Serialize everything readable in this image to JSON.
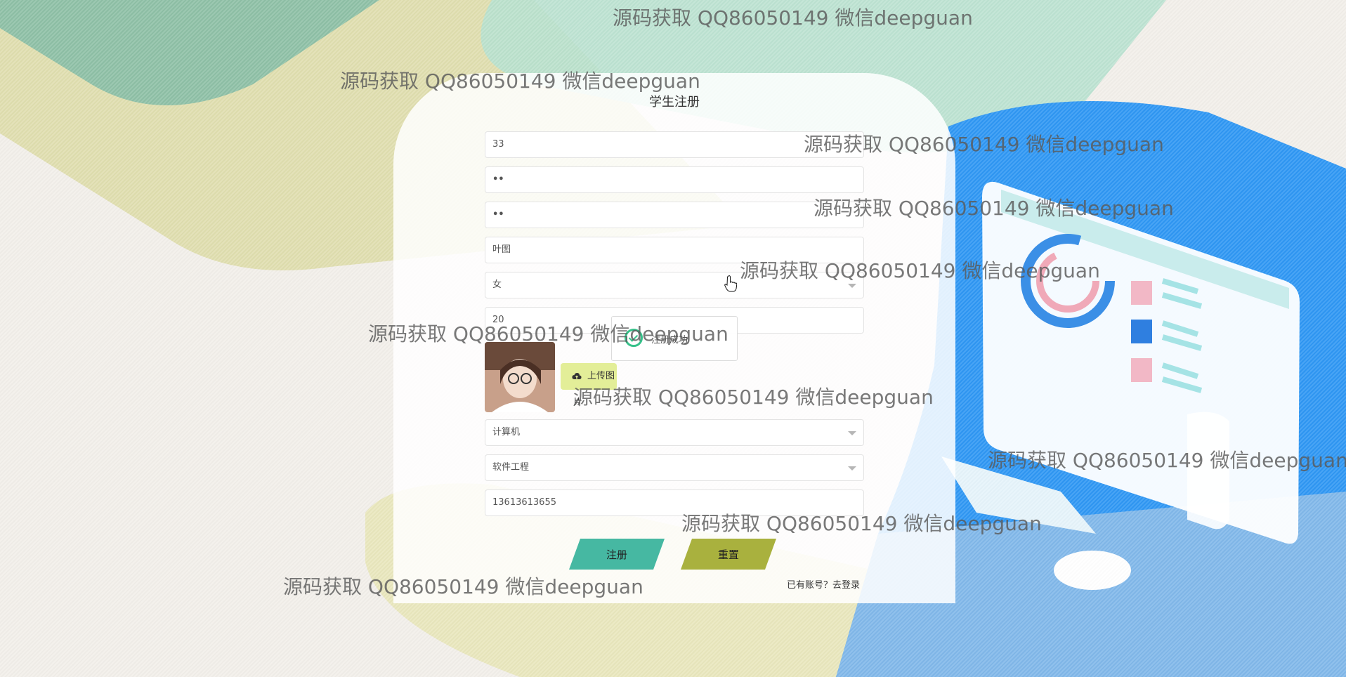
{
  "colors": {
    "background": "#f2efea",
    "green_band": "#8ec0a6",
    "olive_band": "#dedba9",
    "mint_band": "#b7e1cf",
    "blue_panel": "#2f97f4",
    "register_button": "#46b8a2",
    "reset_button": "#a9b13e",
    "upload_button": "#e3ee98",
    "success_icon": "#36c18a"
  },
  "form": {
    "title": "学生注册",
    "fields": {
      "student_no": {
        "value": "33"
      },
      "password": {
        "value": "••"
      },
      "confirm_password": {
        "value": "••"
      },
      "name": {
        "value": "叶图"
      },
      "gender": {
        "value": "女"
      },
      "age": {
        "value": "20"
      },
      "college": {
        "value": "计算机"
      },
      "major": {
        "value": "软件工程"
      },
      "phone": {
        "value": "13613613655"
      }
    },
    "upload_label": "上传图片",
    "register_label": "注册",
    "reset_label": "重置",
    "login_prompt": "已有账号？",
    "login_link": "去登录"
  },
  "toast": {
    "message": "注册成功"
  },
  "watermark": {
    "text": "源码获取 QQ86050149 微信deepguan"
  },
  "icons": {
    "upload": "cloud-upload-icon",
    "success": "check-circle-icon",
    "cursor": "hand-pointer-icon"
  }
}
